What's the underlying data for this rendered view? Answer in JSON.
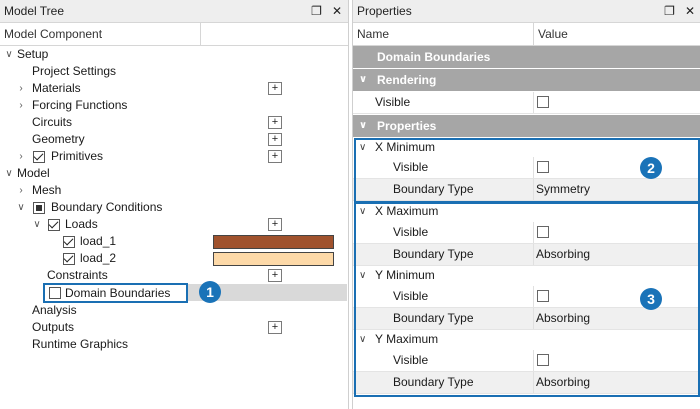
{
  "model_tree": {
    "title": "Model Tree",
    "pin_icon": "pin-icon",
    "close_icon": "close-icon",
    "column_header": "Model Component",
    "nodes": [
      {
        "label": "Setup"
      },
      {
        "label": "Project Settings"
      },
      {
        "label": "Materials"
      },
      {
        "label": "Forcing Functions"
      },
      {
        "label": "Circuits"
      },
      {
        "label": "Geometry"
      },
      {
        "label": "Primitives"
      },
      {
        "label": "Model"
      },
      {
        "label": "Mesh"
      },
      {
        "label": "Boundary Conditions"
      },
      {
        "label": "Loads"
      },
      {
        "label": "load_1",
        "color": "#a0522d"
      },
      {
        "label": "load_2",
        "color": "#fdd9a8"
      },
      {
        "label": "Constraints"
      },
      {
        "label": "Domain Boundaries"
      },
      {
        "label": "Analysis"
      },
      {
        "label": "Outputs"
      },
      {
        "label": "Runtime Graphics"
      }
    ],
    "callout_1": "1"
  },
  "properties": {
    "title": "Properties",
    "col_name": "Name",
    "col_value": "Value",
    "header_title": "Domain Boundaries",
    "section_rendering": "Rendering",
    "visible_label": "Visible",
    "section_properties": "Properties",
    "groups": [
      {
        "name": "X Minimum",
        "visible_label": "Visible",
        "type_label": "Boundary Type",
        "type_value": "Symmetry"
      },
      {
        "name": "X Maximum",
        "visible_label": "Visible",
        "type_label": "Boundary Type",
        "type_value": "Absorbing"
      },
      {
        "name": "Y Minimum",
        "visible_label": "Visible",
        "type_label": "Boundary Type",
        "type_value": "Absorbing"
      },
      {
        "name": "Y Maximum",
        "visible_label": "Visible",
        "type_label": "Boundary Type",
        "type_value": "Absorbing"
      }
    ],
    "callout_2": "2",
    "callout_3": "3",
    "accent_color": "#1a6fb3"
  }
}
